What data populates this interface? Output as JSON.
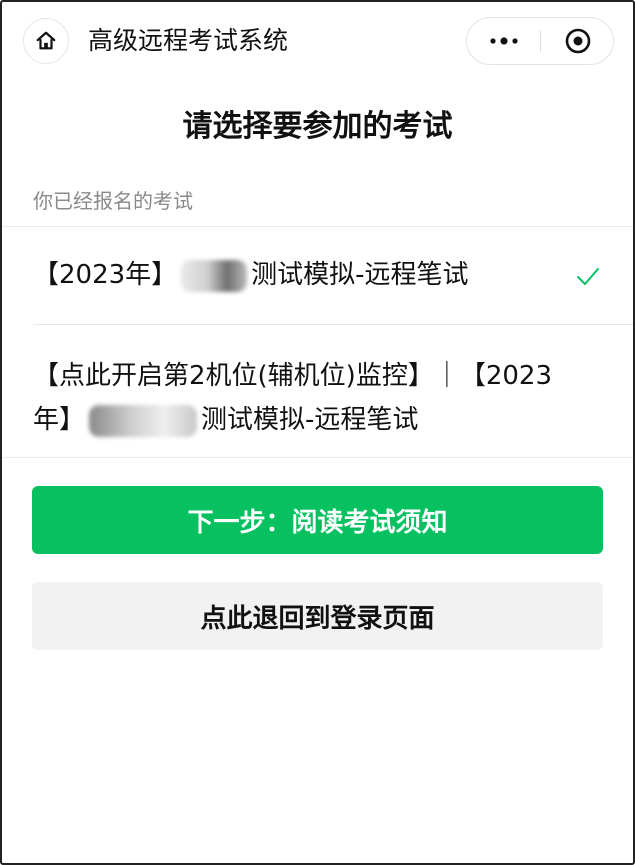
{
  "header": {
    "title": "高级远程考试系统",
    "home_icon": "home-icon",
    "more_icon": "more-dots-icon",
    "close_icon": "target-close-icon"
  },
  "page": {
    "heading": "请选择要参加的考试",
    "section_label": "你已经报名的考试"
  },
  "exams": [
    {
      "prefix": "【2023年】",
      "suffix": "测试模拟-远程笔试",
      "selected": true,
      "status_icon": "check-icon"
    },
    {
      "line1": "【点此开启第2机位(辅机位)监控】｜【2023",
      "line2_prefix": "年】",
      "line2_suffix": "测试模拟-远程笔试",
      "selected": false
    }
  ],
  "actions": {
    "next_label": "下一步：阅读考试须知",
    "back_label": "点此退回到登录页面"
  },
  "colors": {
    "primary": "#07c160",
    "check": "#07c160",
    "muted_text": "#8a8a8a",
    "secondary_button_bg": "#f2f2f2"
  }
}
